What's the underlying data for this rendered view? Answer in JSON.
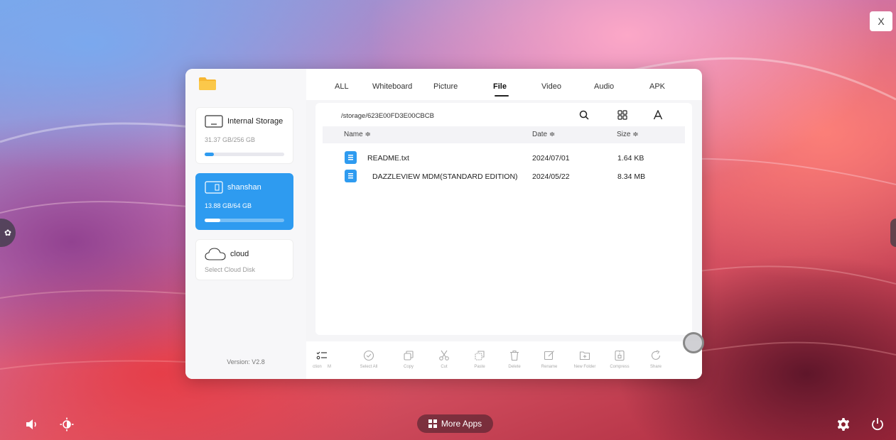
{
  "window": {
    "close_label": "X"
  },
  "sidebar": {
    "storages": [
      {
        "name": "Internal Storage",
        "usage": "31.37 GB/256 GB",
        "progress": 0.12
      },
      {
        "name": "shanshan",
        "usage": "13.88 GB/64 GB",
        "progress": 0.2
      },
      {
        "name": "cloud",
        "usage": "Select Cloud Disk"
      }
    ],
    "version": "Version: V2.8"
  },
  "tabs": [
    "ALL",
    "Whiteboard",
    "Picture",
    "File",
    "Video",
    "Audio",
    "APK"
  ],
  "active_tab": "File",
  "path": "/storage/623E00FD3E00CBCB",
  "columns": {
    "name": "Name ≑",
    "date": "Date ≑",
    "size": "Size ≑"
  },
  "files": [
    {
      "name": "README.txt",
      "date": "2024/07/01",
      "size": "1.64 KB"
    },
    {
      "name": "DAZZLEVIEW MDM(STANDARD EDITION)",
      "date": "2024/05/22",
      "size": "8.34 MB"
    }
  ],
  "toolbar": {
    "selection": "ction",
    "multi": "M",
    "select_all": "Select All",
    "copy": "Copy",
    "cut": "Cut",
    "paste": "Paste",
    "delete": "Delete",
    "rename": "Rename",
    "new_folder": "New Folder",
    "compress": "Compress",
    "share": "Share"
  },
  "taskbar": {
    "more_apps": "More Apps"
  },
  "colors": {
    "accent": "#2e9bf0",
    "card_active": "#2e9bf0"
  },
  "icons": [
    "speaker-icon",
    "brightness-icon",
    "grid-icon",
    "gear-icon",
    "power-icon",
    "search-icon",
    "view-grid-icon",
    "font-icon"
  ]
}
